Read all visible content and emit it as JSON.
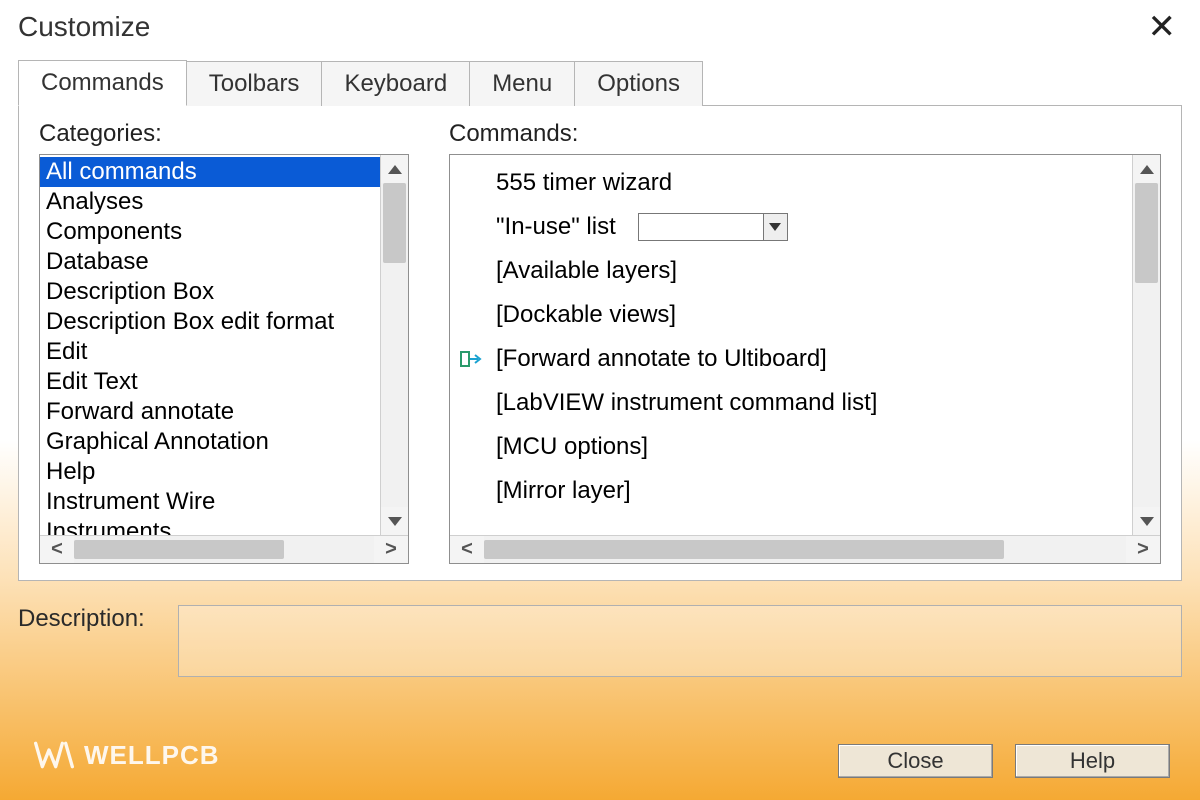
{
  "window": {
    "title": "Customize"
  },
  "tabs": [
    {
      "label": "Commands",
      "active": true
    },
    {
      "label": "Toolbars",
      "active": false
    },
    {
      "label": "Keyboard",
      "active": false
    },
    {
      "label": "Menu",
      "active": false
    },
    {
      "label": "Options",
      "active": false
    }
  ],
  "categories": {
    "label": "Categories:",
    "items": [
      "All commands",
      "Analyses",
      "Components",
      "Database",
      "Description Box",
      "Description Box edit format",
      "Edit",
      "Edit Text",
      "Forward annotate",
      "Graphical Annotation",
      "Help",
      "Instrument Wire",
      "Instruments"
    ],
    "selected_index": 0
  },
  "commands": {
    "label": "Commands:",
    "items": [
      {
        "text": "555 timer wizard",
        "has_combo": false,
        "icon": null
      },
      {
        "text": "\"In-use\" list",
        "has_combo": true,
        "icon": null
      },
      {
        "text": "[Available layers]",
        "has_combo": false,
        "icon": null
      },
      {
        "text": "[Dockable views]",
        "has_combo": false,
        "icon": null
      },
      {
        "text": "[Forward annotate to Ultiboard]",
        "has_combo": false,
        "icon": "forward-arrow"
      },
      {
        "text": "[LabVIEW instrument command list]",
        "has_combo": false,
        "icon": null
      },
      {
        "text": "[MCU options]",
        "has_combo": false,
        "icon": null
      },
      {
        "text": "[Mirror layer]",
        "has_combo": false,
        "icon": null
      }
    ]
  },
  "description": {
    "label": "Description:"
  },
  "buttons": {
    "close": "Close",
    "help": "Help"
  },
  "watermark": {
    "text": "WELLPCB"
  }
}
